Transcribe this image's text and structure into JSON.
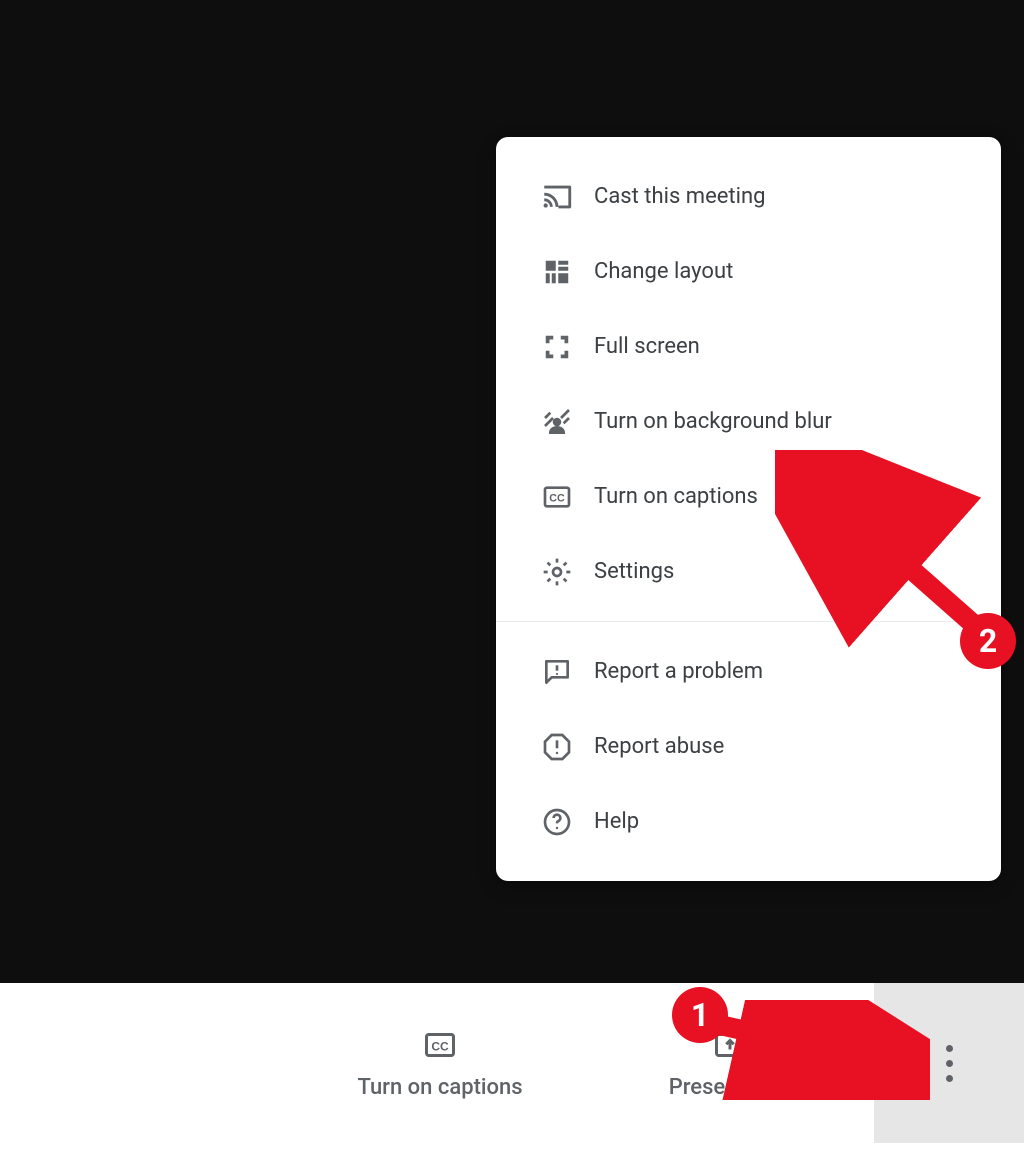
{
  "menu": {
    "items": [
      {
        "label": "Cast this meeting"
      },
      {
        "label": "Change layout"
      },
      {
        "label": "Full screen"
      },
      {
        "label": "Turn on background blur"
      },
      {
        "label": "Turn on captions"
      },
      {
        "label": "Settings"
      }
    ],
    "secondary_items": [
      {
        "label": "Report a problem"
      },
      {
        "label": "Report abuse"
      },
      {
        "label": "Help"
      }
    ]
  },
  "bottom_bar": {
    "captions_label": "Turn on captions",
    "present_label": "Present now"
  },
  "annotations": {
    "step1": "1",
    "step2": "2"
  },
  "colors": {
    "annotation_red": "#e81123",
    "icon_gray": "#5f6368",
    "text_gray": "#3c4043"
  }
}
